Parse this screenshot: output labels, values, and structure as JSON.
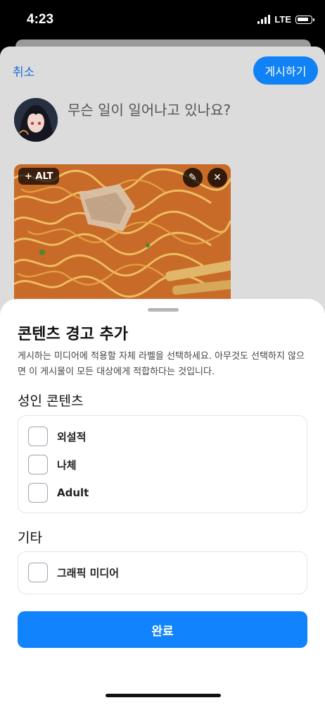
{
  "status_bar": {
    "time": "4:23",
    "network": "LTE"
  },
  "composer": {
    "cancel_label": "취소",
    "post_label": "게시하기",
    "prompt_placeholder": "무슨 일이 일어나고 있나요?",
    "media": {
      "alt_label": "+ ALT",
      "edit_icon": "pencil-icon",
      "remove_icon": "close-icon"
    }
  },
  "sheet": {
    "title": "콘텐츠 경고 추가",
    "description": "게시하는 미디어에 적용할 자체 라벨을 선택하세요. 아무것도 선택하지 않으면 이 게시물이 모든 대상에게 적합하다는 것입니다.",
    "adult_section": {
      "title": "성인 콘텐츠",
      "options": [
        {
          "label": "외설적",
          "checked": false
        },
        {
          "label": "나체",
          "checked": false
        },
        {
          "label": "Adult",
          "checked": false
        }
      ]
    },
    "other_section": {
      "title": "기타",
      "options": [
        {
          "label": "그래픽 미디어",
          "checked": false
        }
      ]
    },
    "done_label": "완료"
  },
  "colors": {
    "accent": "#1083fd",
    "link": "#1d6fd6"
  }
}
